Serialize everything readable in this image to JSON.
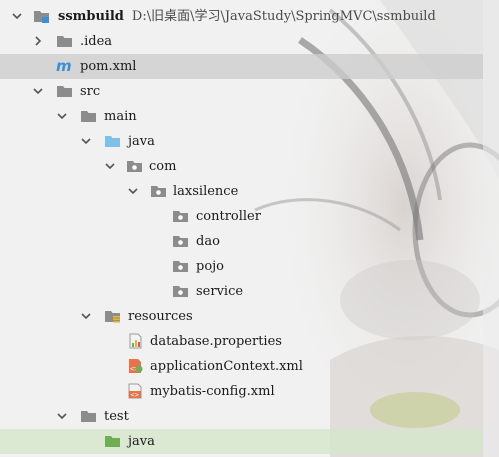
{
  "colors": {
    "folder": "#8c8c8c",
    "source_folder": "#7fc1e6",
    "test_folder": "#6fae52",
    "maven": "#3b8fd6",
    "selection": "#cdcdcd",
    "test_row": "#d6e7ca"
  },
  "tree": [
    {
      "label": "ssmbuild",
      "path": "D:\\旧桌面\\学习\\JavaStudy\\SpringMVC\\ssmbuild",
      "icon": "module-folder-icon",
      "expanded": true
    },
    {
      "label": ".idea",
      "icon": "folder-icon",
      "expanded": false
    },
    {
      "label": "pom.xml",
      "icon": "maven-icon"
    },
    {
      "label": "src",
      "icon": "folder-icon",
      "expanded": true
    },
    {
      "label": "main",
      "icon": "folder-icon",
      "expanded": true
    },
    {
      "label": "java",
      "icon": "source-folder-icon",
      "expanded": true
    },
    {
      "label": "com",
      "icon": "package-icon",
      "expanded": true
    },
    {
      "label": "laxsilence",
      "icon": "package-icon",
      "expanded": true
    },
    {
      "label": "controller",
      "icon": "package-icon"
    },
    {
      "label": "dao",
      "icon": "package-icon"
    },
    {
      "label": "pojo",
      "icon": "package-icon"
    },
    {
      "label": "service",
      "icon": "package-icon"
    },
    {
      "label": "resources",
      "icon": "resources-folder-icon",
      "expanded": true
    },
    {
      "label": "database.properties",
      "icon": "properties-file-icon"
    },
    {
      "label": "applicationContext.xml",
      "icon": "spring-xml-icon"
    },
    {
      "label": "mybatis-config.xml",
      "icon": "xml-file-icon"
    },
    {
      "label": "test",
      "icon": "folder-icon",
      "expanded": true
    },
    {
      "label": "java",
      "icon": "test-source-folder-icon"
    }
  ]
}
